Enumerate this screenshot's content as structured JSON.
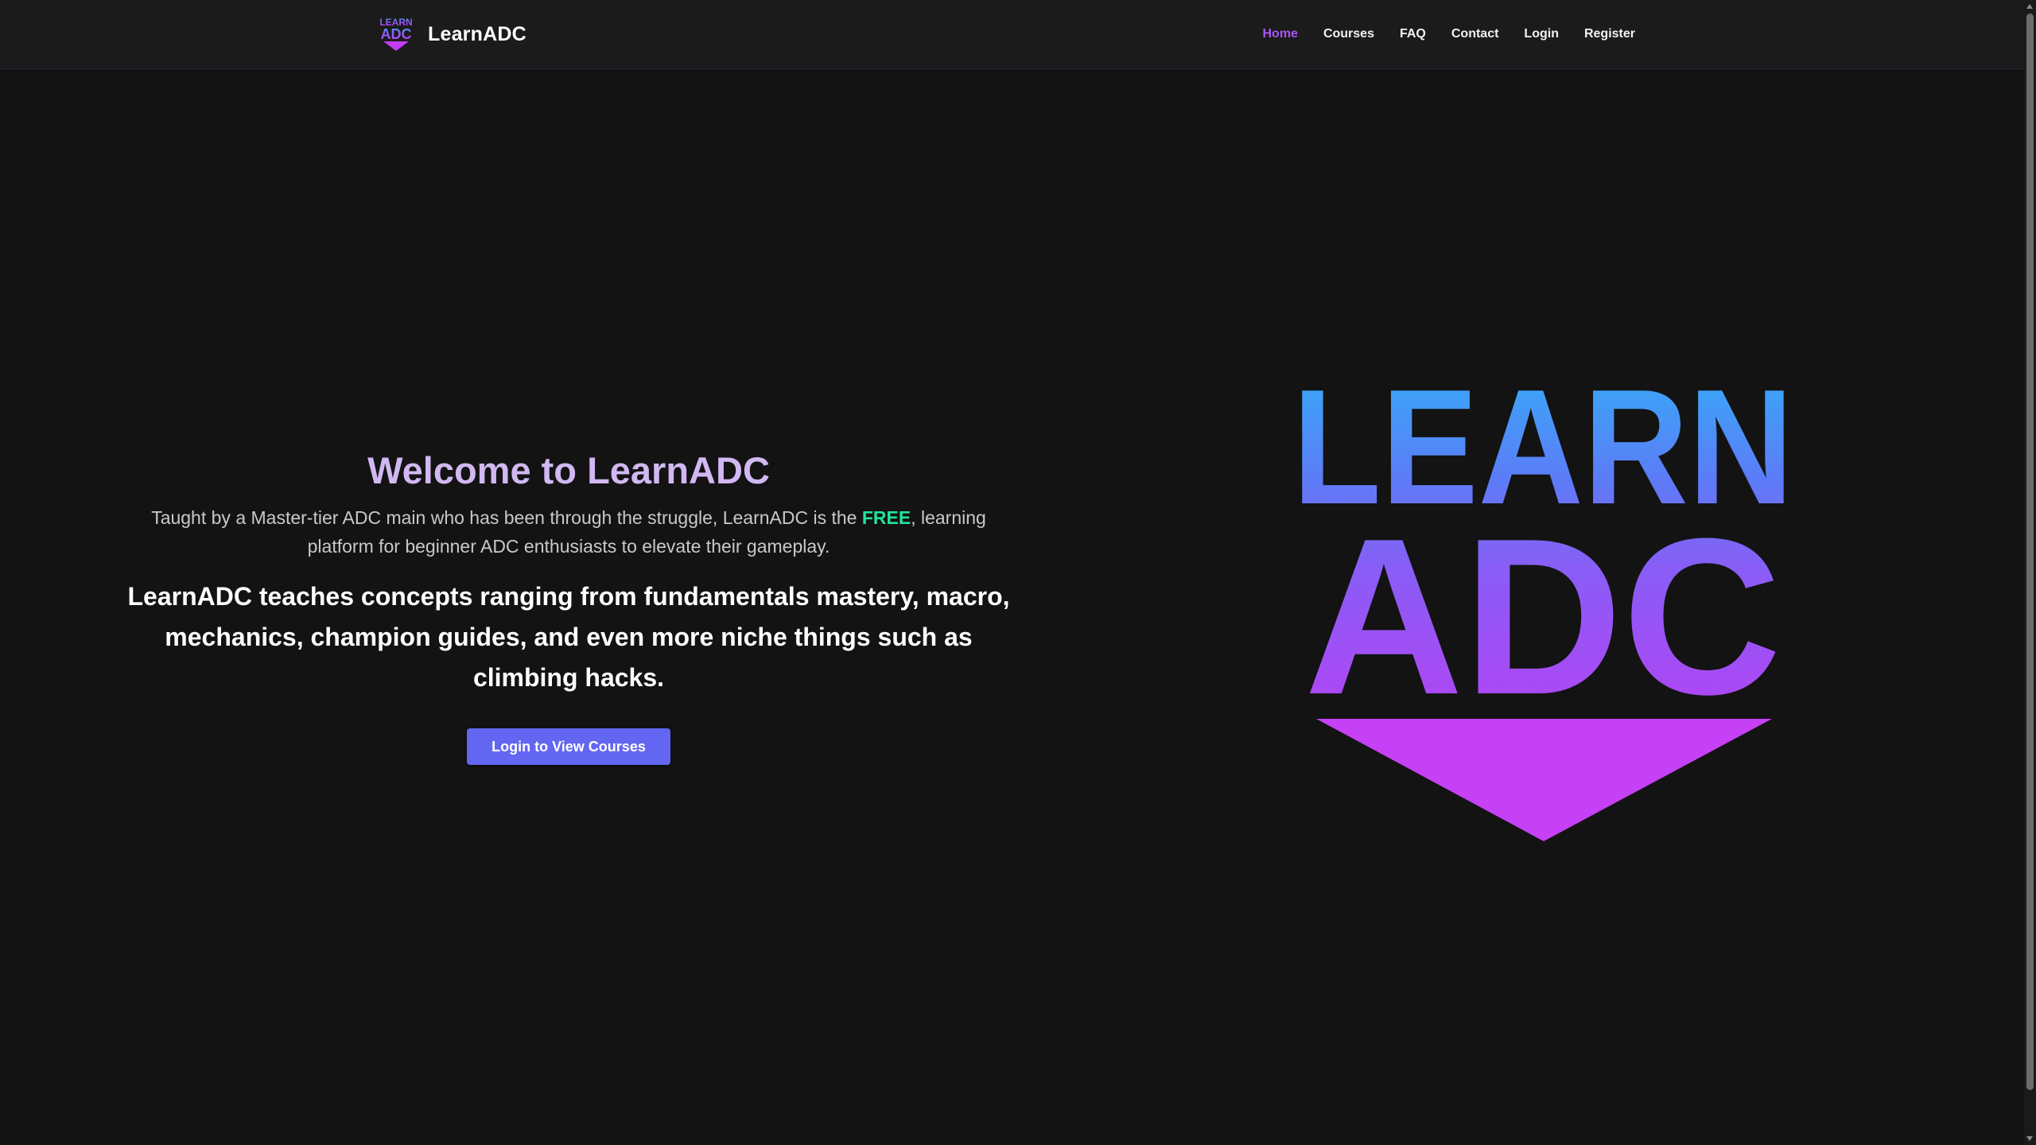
{
  "navbar": {
    "brand_name": "LearnADC",
    "logo_text_top": "LEARN",
    "logo_text_bottom": "ADC",
    "links": [
      {
        "label": "Home",
        "active": true
      },
      {
        "label": "Courses",
        "active": false
      },
      {
        "label": "FAQ",
        "active": false
      },
      {
        "label": "Contact",
        "active": false
      },
      {
        "label": "Login",
        "active": false
      },
      {
        "label": "Register",
        "active": false
      }
    ]
  },
  "hero": {
    "title": "Welcome to LearnADC",
    "desc_before": "Taught by a Master-tier ADC main who has been through the struggle, LearnADC is the ",
    "desc_highlight": "FREE",
    "desc_after": ", learning platform for beginner ADC enthusiasts to elevate their gameplay.",
    "concepts": "LearnADC teaches concepts ranging from fundamentals mastery, macro, mechanics, champion guides, and even more niche things such as climbing hacks.",
    "cta_label": "Login to View Courses",
    "logo_text_top": "LEARN",
    "logo_text_bottom": "ADC"
  },
  "colors": {
    "background": "#131313",
    "navbar": "#1b1b1b",
    "accent_purple": "#a855f7",
    "title": "#d1b8f2",
    "free_highlight": "#22e39a",
    "button": "#6366f1",
    "logo_gradient_top": "#38a8f8",
    "logo_gradient_mid": "#8b5cf6",
    "logo_gradient_bottom": "#c43df2"
  },
  "icons": {
    "brand": "learnadc-logo-icon",
    "hero": "learnadc-hero-logo"
  }
}
